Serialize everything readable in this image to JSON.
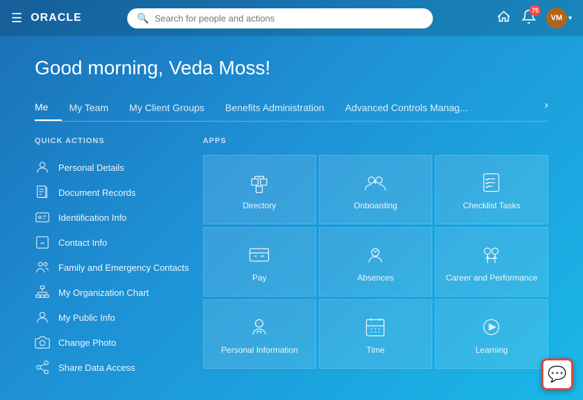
{
  "header": {
    "logo": "ORACLE",
    "search_placeholder": "Search for people and actions",
    "bell_count": "75",
    "avatar_initials": "VM"
  },
  "greeting": "Good morning, Veda Moss!",
  "tabs": {
    "items": [
      {
        "label": "Me",
        "active": true
      },
      {
        "label": "My Team",
        "active": false
      },
      {
        "label": "My Client Groups",
        "active": false
      },
      {
        "label": "Benefits Administration",
        "active": false
      },
      {
        "label": "Advanced Controls Manag...",
        "active": false
      }
    ],
    "arrow": "›"
  },
  "quick_actions": {
    "label": "QUICK ACTIONS",
    "items": [
      {
        "label": "Personal Details"
      },
      {
        "label": "Document Records"
      },
      {
        "label": "Identification Info"
      },
      {
        "label": "Contact Info"
      },
      {
        "label": "Family and Emergency Contacts"
      },
      {
        "label": "My Organization Chart"
      },
      {
        "label": "My Public Info"
      },
      {
        "label": "Change Photo"
      },
      {
        "label": "Share Data Access"
      }
    ]
  },
  "apps": {
    "label": "APPS",
    "items": [
      {
        "label": "Directory",
        "icon": "directory"
      },
      {
        "label": "Onboarding",
        "icon": "onboarding"
      },
      {
        "label": "Checklist Tasks",
        "icon": "checklist"
      },
      {
        "label": "Pay",
        "icon": "pay"
      },
      {
        "label": "Absences",
        "icon": "absences"
      },
      {
        "label": "Career and Performance",
        "icon": "career"
      },
      {
        "label": "Personal Information",
        "icon": "personal"
      },
      {
        "label": "Time",
        "icon": "time"
      },
      {
        "label": "Learning",
        "icon": "learning"
      }
    ]
  },
  "chat": {
    "label": "Chat"
  }
}
